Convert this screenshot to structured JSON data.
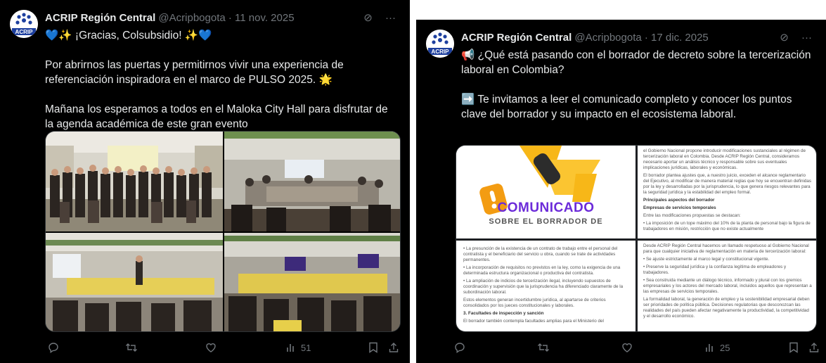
{
  "tweets": [
    {
      "account_name": "ACRIP Región Central",
      "handle": "@Acripbogota",
      "date": "· 11 nov. 2025",
      "avatar_caption": "ACRIP",
      "lines": [
        "💙✨ ¡Gracias, Colsubsidio! ✨💙",
        "",
        "Por abrirnos las puertas y permitirnos vivir una experiencia de referenciación inspiradora en el marco de PULSO 2025. 🌟",
        "",
        "Mañana los esperamos a todos en el Maloka City Hall para disfrutar de la agenda académica de este gran evento"
      ],
      "views": "51"
    },
    {
      "account_name": "ACRIP Región Central",
      "handle": "@Acripbogota",
      "date": "· 17 dic. 2025",
      "avatar_caption": "ACRIP",
      "lines": [
        "📢 ¿Qué está pasando con el borrador de decreto sobre la tercerización laboral en Colombia?",
        "",
        "➡️ Te invitamos a leer el comunicado completo y conocer los puntos clave del borrador y su impacto en el ecosistema laboral."
      ],
      "views": "25",
      "doc": {
        "cover_title": "COMUNICADO",
        "cover_subtitle": "SOBRE EL BORRADOR DE",
        "tr_p1": "el Gobierno Nacional propone introducir modificaciones sustanciales al régimen de tercerización laboral en Colombia. Desde ACRIP Región Central, consideramos necesario aportar un análisis técnico y responsable sobre sus eventuales implicaciones jurídicas, laborales y económicas.",
        "tr_p2": "El borrador plantea ajustes que, a nuestro juicio, exceden el alcance reglamentario del Ejecutivo, al modificar de manera material reglas que hoy se encuentran definidas por la ley y desarrolladas por la jurisprudencia, lo que genera riesgos relevantes para la seguridad jurídica y la estabilidad del empleo formal.",
        "tr_h1": "Principales aspectos del borrador",
        "tr_h2": "Empresas de servicios temporales",
        "tr_p3": "Entre las modificaciones propuestas se destacan:",
        "tr_p4": "• La imposición de un tope máximo del 10% de la planta de personal bajo la figura de trabajadores en misión, restricción que no existe actualmente",
        "bl_p1": "• La presunción de la existencia de un contrato de trabajo entre el personal del contratista y el beneficiario del servicio u obra, cuando se trate de actividades permanentes.",
        "bl_p2": "• La incorporación de requisitos no previstos en la ley, como la exigencia de una determinada estructura organizacional o productiva del contratista.",
        "bl_p3": "• La ampliación de indicios de tercerización ilegal, incluyendo supuestos de coordinación y supervisión que la jurisprudencia ha diferenciado claramente de la subordinación laboral.",
        "bl_p4": "Estos elementos generan incertidumbre jurídica, al apartarse de criterios consolidados por los jueces constitucionales y laborales.",
        "bl_h1": "3. Facultades de inspección y sanción",
        "bl_p5": "El borrador también contempla facultades amplias para el Ministerio del",
        "br_p1": "Desde ACRIP Región Central hacemos un llamado respetuoso al Gobierno Nacional para que cualquier iniciativa de reglamentación en materia de tercerización laboral:",
        "br_p2": "• Se ajuste estrictamente al marco legal y constitucional vigente.",
        "br_p3": "• Preserve la seguridad jurídica y la confianza legítima de empleadores y trabajadores.",
        "br_p4": "• Sea construida mediante un diálogo técnico, informado y plural con los gremios empresariales y los actores del mercado laboral, incluidos aquellos que representan a las empresas de servicios temporales.",
        "br_p5": "La formalidad laboral, la generación de empleo y la sostenibilidad empresarial deben ser prioridades de política pública. Decisiones regulatorias que desconozcan las realidades del país pueden afectar negativamente la productividad, la competitividad y el desarrollo económico."
      }
    }
  ]
}
